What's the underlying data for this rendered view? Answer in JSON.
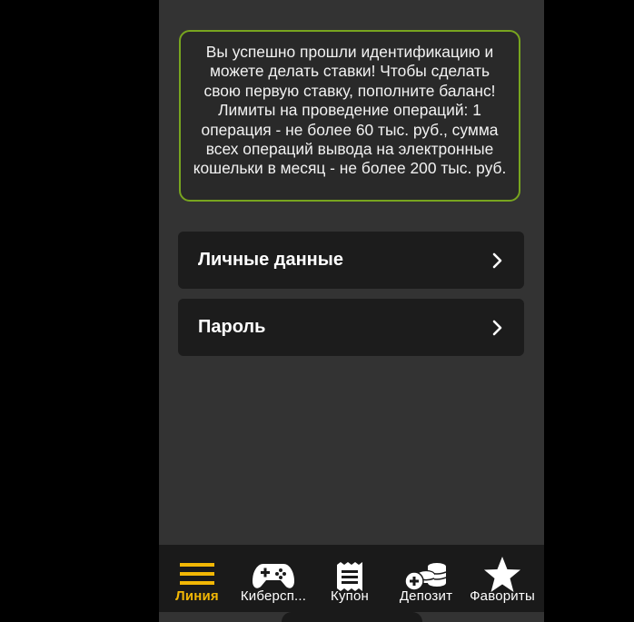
{
  "notice": {
    "text": "Вы успешно прошли идентификацию и можете делать ставки! Чтобы сделать свою первую ставку, пополните баланс! Лимиты на проведение операций: 1 операция - не более 60 тыс. руб., сумма всех операций вывода на электронные кошельки в месяц - не более 200 тыс. руб."
  },
  "menu": [
    {
      "label": "Личные данные",
      "icon": "chevron-right-icon"
    },
    {
      "label": "Пароль",
      "icon": "chevron-right-icon"
    }
  ],
  "bottom_nav": {
    "items": [
      {
        "label": "Линия",
        "icon": "menu-lines-icon",
        "active": true
      },
      {
        "label": "Киберсп...",
        "icon": "gamepad-icon",
        "active": false
      },
      {
        "label": "Купон",
        "icon": "coupon-icon",
        "active": false
      },
      {
        "label": "Депозит",
        "icon": "deposit-coins-icon",
        "active": false
      },
      {
        "label": "Фавориты",
        "icon": "star-icon",
        "active": false
      }
    ]
  },
  "colors": {
    "accent": "#f2b705",
    "notice_border": "#78a51f",
    "panel_bg": "#333333",
    "card_bg": "#1c1c1c"
  }
}
